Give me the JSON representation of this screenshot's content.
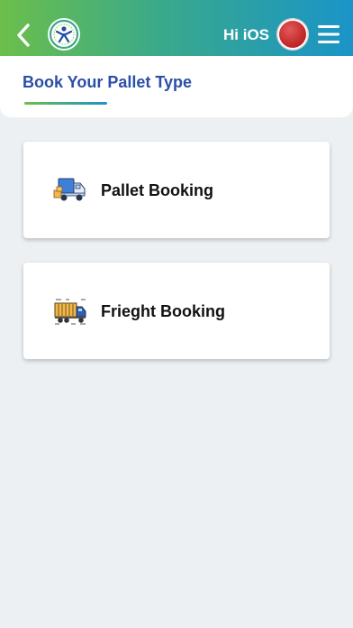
{
  "header": {
    "greeting": "Hi iOS",
    "icons": {
      "back": "chevron-left-icon",
      "logo": "logo-icon",
      "avatar": "avatar",
      "menu": "hamburger-menu-icon"
    },
    "colors": {
      "gradient_start": "#6cbf4a",
      "gradient_end": "#1a94c8"
    }
  },
  "page": {
    "title": "Book Your Pallet Type",
    "title_color": "#2b4fa8"
  },
  "options": [
    {
      "label": "Pallet Booking",
      "icon": "delivery-van-with-boxes-icon"
    },
    {
      "label": "Frieght Booking",
      "icon": "freight-truck-icon"
    }
  ]
}
